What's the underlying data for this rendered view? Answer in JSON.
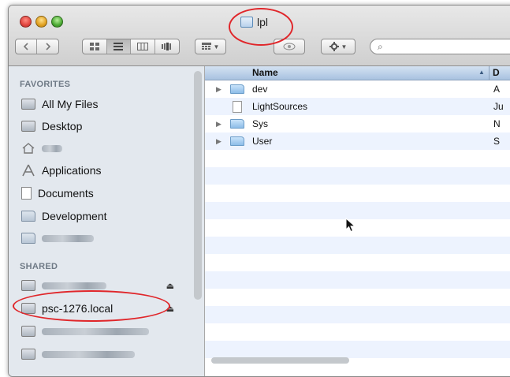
{
  "window": {
    "title": "lpl",
    "folder_icon": "folder-icon",
    "traffic_lights": {
      "close_color": "#e0443e",
      "minimize_color": "#e0a020",
      "zoom_color": "#4aa832"
    }
  },
  "toolbar": {
    "back_icon": "chevron-left-icon",
    "forward_icon": "chevron-right-icon",
    "view_modes": [
      "icon-view",
      "list-view",
      "column-view",
      "cover-flow-view"
    ],
    "active_view": "list-view",
    "arrange_icon": "arrange-grid-icon",
    "quicklook_icon": "eye-icon",
    "action_icon": "gear-icon",
    "search_glyph": "⌕",
    "search_placeholder": ""
  },
  "sidebar": {
    "favorites_header": "FAVORITES",
    "favorites": [
      {
        "label": "All My Files",
        "icon": "all-files-icon"
      },
      {
        "label": "Desktop",
        "icon": "desktop-icon"
      },
      {
        "label": "",
        "icon": "home-icon",
        "obscured": true
      },
      {
        "label": "Applications",
        "icon": "applications-icon"
      },
      {
        "label": "Documents",
        "icon": "documents-icon"
      },
      {
        "label": "Development",
        "icon": "folder-icon"
      },
      {
        "label": "",
        "icon": "folder-icon",
        "obscured": true
      }
    ],
    "shared_header": "SHARED",
    "shared": [
      {
        "label": "",
        "icon": "network-computer-icon",
        "obscured": true,
        "eject": "⏏"
      },
      {
        "label": "psc-1276.local",
        "icon": "network-computer-icon",
        "obscured": false,
        "eject": "⏏"
      },
      {
        "label": "",
        "icon": "network-computer-icon",
        "obscured": true
      },
      {
        "label": "",
        "icon": "network-computer-icon",
        "obscured": true
      }
    ]
  },
  "file_list": {
    "columns": [
      "Name",
      "D"
    ],
    "sort_indicator": "▲",
    "rows": [
      {
        "name": "dev",
        "kind": "folder",
        "expandable": true,
        "date_cut": "A"
      },
      {
        "name": "LightSources",
        "kind": "file",
        "expandable": false,
        "date_cut": "Ju"
      },
      {
        "name": "Sys",
        "kind": "folder",
        "expandable": true,
        "date_cut": "N"
      },
      {
        "name": "User",
        "kind": "folder",
        "expandable": true,
        "date_cut": "S"
      }
    ]
  },
  "colors": {
    "highlight_circle": "#e0262a",
    "sidebar_bg": "#e3e8ee",
    "alt_row": "#edf3fe"
  }
}
